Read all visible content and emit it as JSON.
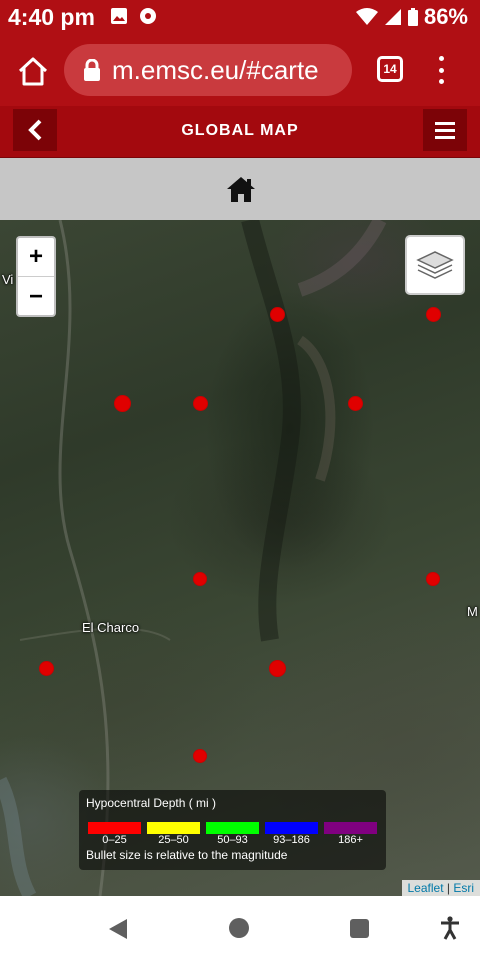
{
  "status": {
    "time": "4:40 pm",
    "battery": "86%"
  },
  "browser": {
    "url": "m.emsc.eu/#carte",
    "tab_count": "14"
  },
  "header": {
    "title": "GLOBAL MAP"
  },
  "map": {
    "zoom_in": "+",
    "zoom_out": "−",
    "places": [
      {
        "name": "El Charco"
      },
      {
        "name": "Vi"
      },
      {
        "name": "M"
      }
    ]
  },
  "legend": {
    "title": "Hypocentral Depth ( mi )",
    "ranges": [
      {
        "label": "0–25",
        "color": "#ff0000"
      },
      {
        "label": "25–50",
        "color": "#ffff00"
      },
      {
        "label": "50–93",
        "color": "#00ff00"
      },
      {
        "label": "93–186",
        "color": "#0000ff"
      },
      {
        "label": "186+",
        "color": "#800080"
      }
    ],
    "note": "Bullet size is relative to the magnitude"
  },
  "attribution": {
    "leaflet": "Leaflet",
    "sep": " | ",
    "esri": "Esri"
  }
}
